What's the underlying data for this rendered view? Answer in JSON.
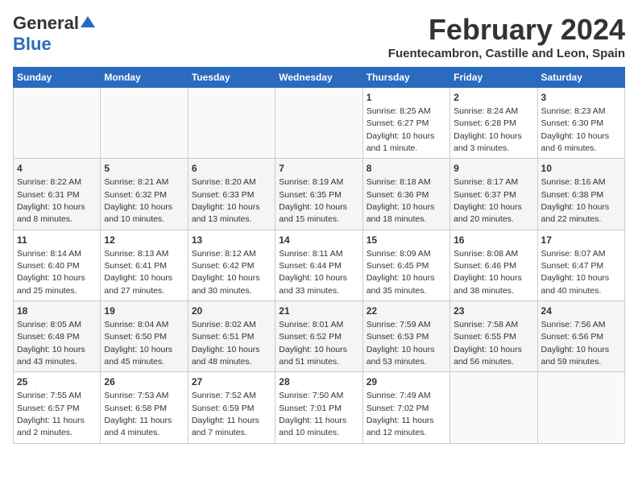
{
  "header": {
    "logo_general": "General",
    "logo_blue": "Blue",
    "month_year": "February 2024",
    "location": "Fuentecambron, Castille and Leon, Spain"
  },
  "weekdays": [
    "Sunday",
    "Monday",
    "Tuesday",
    "Wednesday",
    "Thursday",
    "Friday",
    "Saturday"
  ],
  "weeks": [
    [
      {
        "day": "",
        "info": ""
      },
      {
        "day": "",
        "info": ""
      },
      {
        "day": "",
        "info": ""
      },
      {
        "day": "",
        "info": ""
      },
      {
        "day": "1",
        "info": "Sunrise: 8:25 AM\nSunset: 6:27 PM\nDaylight: 10 hours\nand 1 minute."
      },
      {
        "day": "2",
        "info": "Sunrise: 8:24 AM\nSunset: 6:28 PM\nDaylight: 10 hours\nand 3 minutes."
      },
      {
        "day": "3",
        "info": "Sunrise: 8:23 AM\nSunset: 6:30 PM\nDaylight: 10 hours\nand 6 minutes."
      }
    ],
    [
      {
        "day": "4",
        "info": "Sunrise: 8:22 AM\nSunset: 6:31 PM\nDaylight: 10 hours\nand 8 minutes."
      },
      {
        "day": "5",
        "info": "Sunrise: 8:21 AM\nSunset: 6:32 PM\nDaylight: 10 hours\nand 10 minutes."
      },
      {
        "day": "6",
        "info": "Sunrise: 8:20 AM\nSunset: 6:33 PM\nDaylight: 10 hours\nand 13 minutes."
      },
      {
        "day": "7",
        "info": "Sunrise: 8:19 AM\nSunset: 6:35 PM\nDaylight: 10 hours\nand 15 minutes."
      },
      {
        "day": "8",
        "info": "Sunrise: 8:18 AM\nSunset: 6:36 PM\nDaylight: 10 hours\nand 18 minutes."
      },
      {
        "day": "9",
        "info": "Sunrise: 8:17 AM\nSunset: 6:37 PM\nDaylight: 10 hours\nand 20 minutes."
      },
      {
        "day": "10",
        "info": "Sunrise: 8:16 AM\nSunset: 6:38 PM\nDaylight: 10 hours\nand 22 minutes."
      }
    ],
    [
      {
        "day": "11",
        "info": "Sunrise: 8:14 AM\nSunset: 6:40 PM\nDaylight: 10 hours\nand 25 minutes."
      },
      {
        "day": "12",
        "info": "Sunrise: 8:13 AM\nSunset: 6:41 PM\nDaylight: 10 hours\nand 27 minutes."
      },
      {
        "day": "13",
        "info": "Sunrise: 8:12 AM\nSunset: 6:42 PM\nDaylight: 10 hours\nand 30 minutes."
      },
      {
        "day": "14",
        "info": "Sunrise: 8:11 AM\nSunset: 6:44 PM\nDaylight: 10 hours\nand 33 minutes."
      },
      {
        "day": "15",
        "info": "Sunrise: 8:09 AM\nSunset: 6:45 PM\nDaylight: 10 hours\nand 35 minutes."
      },
      {
        "day": "16",
        "info": "Sunrise: 8:08 AM\nSunset: 6:46 PM\nDaylight: 10 hours\nand 38 minutes."
      },
      {
        "day": "17",
        "info": "Sunrise: 8:07 AM\nSunset: 6:47 PM\nDaylight: 10 hours\nand 40 minutes."
      }
    ],
    [
      {
        "day": "18",
        "info": "Sunrise: 8:05 AM\nSunset: 6:48 PM\nDaylight: 10 hours\nand 43 minutes."
      },
      {
        "day": "19",
        "info": "Sunrise: 8:04 AM\nSunset: 6:50 PM\nDaylight: 10 hours\nand 45 minutes."
      },
      {
        "day": "20",
        "info": "Sunrise: 8:02 AM\nSunset: 6:51 PM\nDaylight: 10 hours\nand 48 minutes."
      },
      {
        "day": "21",
        "info": "Sunrise: 8:01 AM\nSunset: 6:52 PM\nDaylight: 10 hours\nand 51 minutes."
      },
      {
        "day": "22",
        "info": "Sunrise: 7:59 AM\nSunset: 6:53 PM\nDaylight: 10 hours\nand 53 minutes."
      },
      {
        "day": "23",
        "info": "Sunrise: 7:58 AM\nSunset: 6:55 PM\nDaylight: 10 hours\nand 56 minutes."
      },
      {
        "day": "24",
        "info": "Sunrise: 7:56 AM\nSunset: 6:56 PM\nDaylight: 10 hours\nand 59 minutes."
      }
    ],
    [
      {
        "day": "25",
        "info": "Sunrise: 7:55 AM\nSunset: 6:57 PM\nDaylight: 11 hours\nand 2 minutes."
      },
      {
        "day": "26",
        "info": "Sunrise: 7:53 AM\nSunset: 6:58 PM\nDaylight: 11 hours\nand 4 minutes."
      },
      {
        "day": "27",
        "info": "Sunrise: 7:52 AM\nSunset: 6:59 PM\nDaylight: 11 hours\nand 7 minutes."
      },
      {
        "day": "28",
        "info": "Sunrise: 7:50 AM\nSunset: 7:01 PM\nDaylight: 11 hours\nand 10 minutes."
      },
      {
        "day": "29",
        "info": "Sunrise: 7:49 AM\nSunset: 7:02 PM\nDaylight: 11 hours\nand 12 minutes."
      },
      {
        "day": "",
        "info": ""
      },
      {
        "day": "",
        "info": ""
      }
    ]
  ]
}
